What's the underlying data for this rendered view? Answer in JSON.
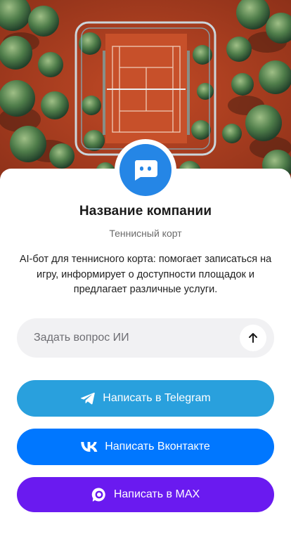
{
  "hero": {
    "image_icon": "tennis-court-aerial-photo"
  },
  "profile": {
    "avatar_icon": "chat-bot-icon",
    "company_name": "Название компании",
    "company_type": "Теннисный корт",
    "description": "AI-бот для теннисного корта: помогает записаться на игру, информирует о доступности площадок и предлагает различные услуги."
  },
  "ask": {
    "placeholder": "Задать вопрос ИИ",
    "value": "",
    "send_icon": "arrow-up-icon"
  },
  "buttons": {
    "telegram": {
      "label": "Написать в Telegram",
      "icon": "telegram-icon",
      "color": "#29a0dd"
    },
    "vk": {
      "label": "Написать Вконтакте",
      "icon": "vk-icon",
      "color": "#0077ff"
    },
    "max": {
      "label": "Написать в MAX",
      "icon": "max-icon",
      "color": "#6a1af0"
    }
  },
  "colors": {
    "accent": "#2586e6",
    "court": "#c44a25"
  }
}
